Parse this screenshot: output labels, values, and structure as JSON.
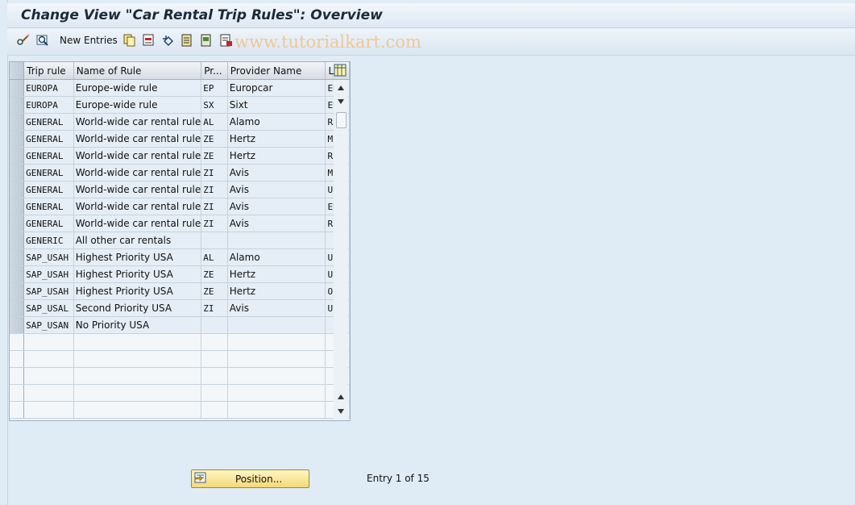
{
  "window": {
    "title": "Change View \"Car Rental Trip Rules\": Overview"
  },
  "toolbar": {
    "new_entries_label": "New Entries",
    "icons": [
      "glasses-pencil-icon",
      "other-view-icon",
      "copy-icon",
      "delete-icon",
      "undo-icon",
      "select-all-icon",
      "select-block-icon",
      "deselect-all-icon"
    ]
  },
  "watermark": "www.tutorialkart.com",
  "table": {
    "columns": [
      "Trip rule",
      "Name of Rule",
      "Pr...",
      "Provider Name",
      "L..."
    ],
    "rows": [
      [
        "EUROPA",
        "Europe-wide rule",
        "EP",
        "Europcar",
        "EU"
      ],
      [
        "EUROPA",
        "Europe-wide rule",
        "SX",
        "Sixt",
        "EU"
      ],
      [
        "GENERAL",
        "World-wide car rental rule",
        "AL",
        "Alamo",
        "R..."
      ],
      [
        "GENERAL",
        "World-wide car rental rule",
        "ZE",
        "Hertz",
        "M..."
      ],
      [
        "GENERAL",
        "World-wide car rental rule",
        "ZE",
        "Hertz",
        "R..."
      ],
      [
        "GENERAL",
        "World-wide car rental rule",
        "ZI",
        "Avis",
        "M..."
      ],
      [
        "GENERAL",
        "World-wide car rental rule",
        "ZI",
        "Avis",
        "US"
      ],
      [
        "GENERAL",
        "World-wide car rental rule",
        "ZI",
        "Avis",
        "EU"
      ],
      [
        "GENERAL",
        "World-wide car rental rule",
        "ZI",
        "Avis",
        "R..."
      ],
      [
        "GENERIC",
        "All other car rentals",
        "",
        "",
        ""
      ],
      [
        "SAP_USAH",
        "Highest Priority USA",
        "AL",
        "Alamo",
        "U..."
      ],
      [
        "SAP_USAH",
        "Highest Priority USA",
        "ZE",
        "Hertz",
        "US"
      ],
      [
        "SAP_USAH",
        "Highest Priority USA",
        "ZE",
        "Hertz",
        "O..."
      ],
      [
        "SAP_USAL",
        "Second Priority USA",
        "ZI",
        "Avis",
        "US"
      ],
      [
        "SAP_USAN",
        "No Priority USA",
        "",
        "",
        ""
      ]
    ],
    "empty_rows": 5
  },
  "footer": {
    "position_button": "Position...",
    "entry_info": "Entry 1 of 15"
  },
  "colors": {
    "background": "#dfebf5",
    "button": "#f5d976",
    "watermark": "#f2c48a"
  }
}
